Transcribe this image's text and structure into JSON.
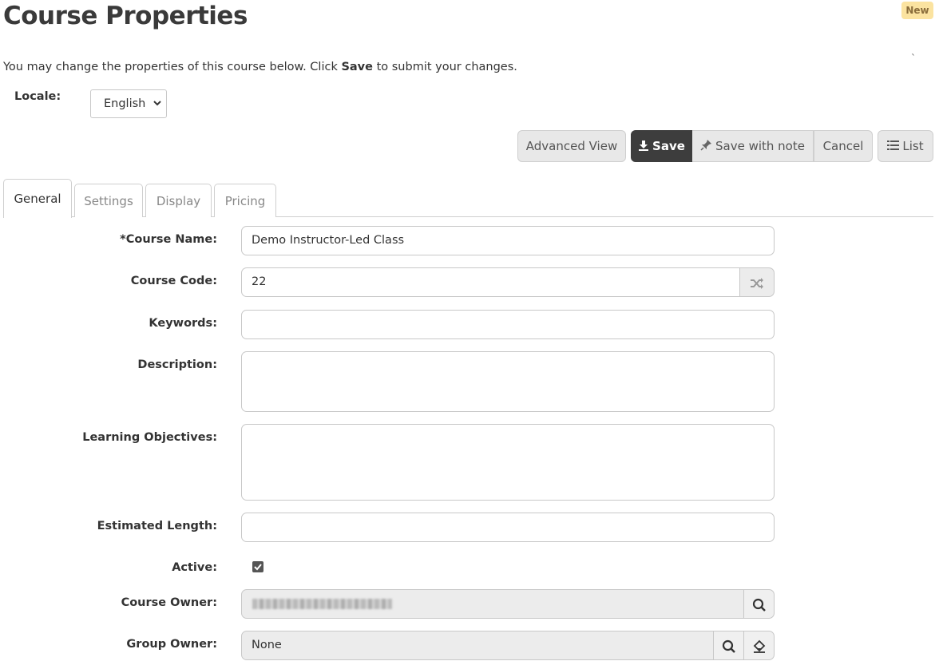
{
  "header": {
    "title": "Course Properties",
    "new_badge": "New",
    "tick": "`"
  },
  "intro": {
    "before": "You may change the properties of this course below. Click ",
    "bold": "Save",
    "after": " to submit your changes."
  },
  "locale": {
    "label": "Locale:",
    "selected": "English"
  },
  "toolbar": {
    "advanced_view": "Advanced View",
    "save": "Save",
    "save_with_note": "Save with note",
    "cancel": "Cancel",
    "list": "List"
  },
  "tabs": [
    {
      "label": "General",
      "active": true
    },
    {
      "label": "Settings",
      "active": false
    },
    {
      "label": "Display",
      "active": false
    },
    {
      "label": "Pricing",
      "active": false
    }
  ],
  "form": {
    "course_name": {
      "label": "*Course Name:",
      "value": "Demo Instructor-Led Class"
    },
    "course_code": {
      "label": "Course Code:",
      "value": "22"
    },
    "keywords": {
      "label": "Keywords:",
      "value": ""
    },
    "description": {
      "label": "Description:",
      "value": ""
    },
    "learning_objectives": {
      "label": "Learning Objectives:",
      "value": ""
    },
    "estimated_length": {
      "label": "Estimated Length:",
      "value": ""
    },
    "active": {
      "label": "Active:",
      "checked": true
    },
    "course_owner": {
      "label": "Course Owner:"
    },
    "group_owner": {
      "label": "Group Owner:",
      "value": "None"
    }
  },
  "colors": {
    "primary_button": "#3d3d3d",
    "badge_bg": "#fbe3a0"
  },
  "icons": [
    "download-icon",
    "pin-icon",
    "list-icon",
    "shuffle-icon",
    "search-icon",
    "eraser-icon",
    "chevron-down-icon",
    "check-icon"
  ]
}
